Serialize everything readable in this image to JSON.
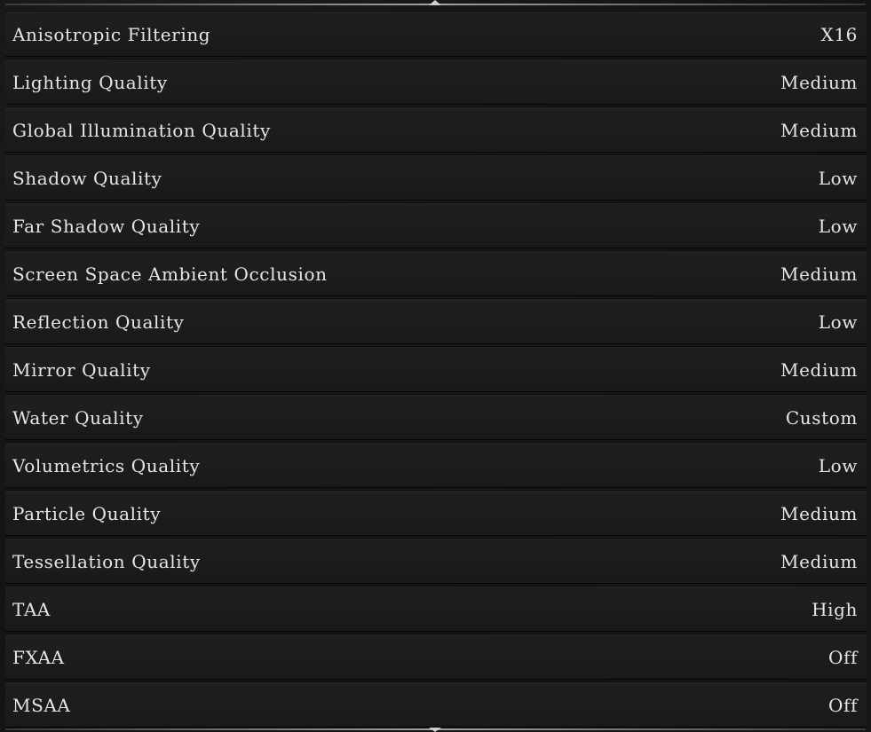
{
  "settings": [
    {
      "label": "Anisotropic Filtering",
      "value": "X16"
    },
    {
      "label": "Lighting Quality",
      "value": "Medium"
    },
    {
      "label": "Global Illumination Quality",
      "value": "Medium"
    },
    {
      "label": "Shadow Quality",
      "value": "Low"
    },
    {
      "label": "Far Shadow Quality",
      "value": "Low"
    },
    {
      "label": "Screen Space Ambient Occlusion",
      "value": "Medium"
    },
    {
      "label": "Reflection Quality",
      "value": "Low"
    },
    {
      "label": "Mirror Quality",
      "value": "Medium"
    },
    {
      "label": "Water Quality",
      "value": "Custom"
    },
    {
      "label": "Volumetrics Quality",
      "value": "Low"
    },
    {
      "label": "Particle Quality",
      "value": "Medium"
    },
    {
      "label": "Tessellation Quality",
      "value": "Medium"
    },
    {
      "label": "TAA",
      "value": "High"
    },
    {
      "label": "FXAA",
      "value": "Off"
    },
    {
      "label": "MSAA",
      "value": "Off"
    }
  ]
}
